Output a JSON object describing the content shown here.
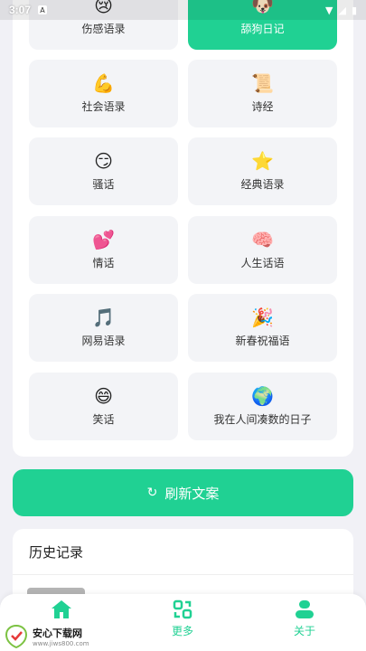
{
  "status": {
    "time": "3:07",
    "notif": "A"
  },
  "categories": [
    {
      "emoji": "😢",
      "label": "伤感语录"
    },
    {
      "emoji": "🐶",
      "label": "舔狗日记",
      "active": true
    },
    {
      "emoji": "💪",
      "label": "社会语录"
    },
    {
      "emoji": "📜",
      "label": "诗经"
    },
    {
      "emoji": "😏",
      "label": "骚话"
    },
    {
      "emoji": "⭐",
      "label": "经典语录"
    },
    {
      "emoji": "💕",
      "label": "情话"
    },
    {
      "emoji": "🧠",
      "label": "人生话语"
    },
    {
      "emoji": "🎵",
      "label": "网易语录"
    },
    {
      "emoji": "🎉",
      "label": "新春祝福语"
    },
    {
      "emoji": "😄",
      "label": "笑话"
    },
    {
      "emoji": "🌍",
      "label": "我在人间凑数的日子"
    }
  ],
  "refresh": {
    "label": "刷新文案",
    "icon": "↻"
  },
  "history": {
    "title": "历史记录"
  },
  "nav": {
    "home_label": "",
    "more_label": "更多",
    "about_label": "关于"
  },
  "watermark": {
    "name": "安心下载网",
    "url": "www.jiws800.com"
  },
  "colors": {
    "accent": "#20d193"
  }
}
